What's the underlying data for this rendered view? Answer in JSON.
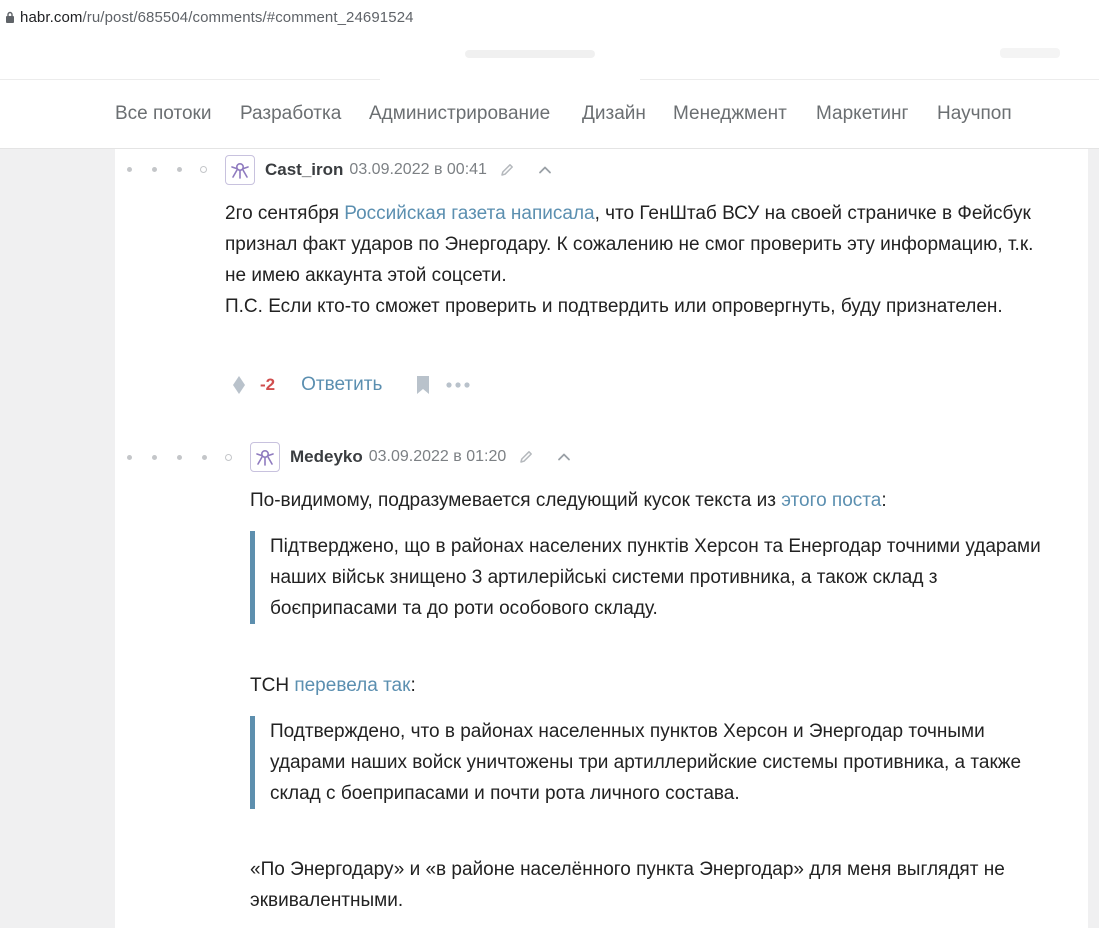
{
  "browser": {
    "url_host": "habr.com",
    "url_path": "/ru/post/685504/comments/#comment_24691524"
  },
  "nav": {
    "items": [
      "Все потоки",
      "Разработка",
      "Администрирование",
      "Дизайн",
      "Менеджмент",
      "Маркетинг",
      "Научпоп"
    ]
  },
  "comments": [
    {
      "username": "Cast_iron",
      "date": "03.09.2022 в 00:41",
      "body": {
        "p1_before": "2го сентября ",
        "p1_link": "Российская газета написала",
        "p1_after": ", что ГенШтаб ВСУ на своей страничке в Фейсбук признал факт ударов по Энергодару. К сожалению не смог проверить эту информацию, т.к. не имею аккаунта этой соцсети.",
        "p2": "П.С. Если кто-то сможет проверить и подтвердить или опровергнуть, буду признателен."
      },
      "score": "-2",
      "reply_label": "Ответить"
    },
    {
      "username": "Medeyko",
      "date": "03.09.2022 в 01:20",
      "intro_before": "По-видимому, подразумевается следующий кусок текста из ",
      "intro_link": "этого поста",
      "intro_after": ":",
      "quote1": "Підтверджено, що в районах населених пунктів Херсон та Енергодар точними ударами наших військ знищено 3 артилерійські системи противника, а також склад з боєприпасами та до роти особового складу.",
      "tsn_before": "ТСН ",
      "tsn_link": "перевела так",
      "tsn_after": ":",
      "quote2": "Подтверждено, что в районах населенных пунктов Херсон и Энергодар точными ударами наших войск уничтожены три артиллерийские системы противника, а также склад с боеприпасами и почти рота личного состава.",
      "conclusion": "«По Энергодару» и «в районе населённого пункта Энергодар» для меня выглядят не эквивалентными."
    }
  ],
  "colors": {
    "link": "#5b8fb0",
    "score_negative": "#d04e4e",
    "quote_border": "#5d8fae"
  }
}
